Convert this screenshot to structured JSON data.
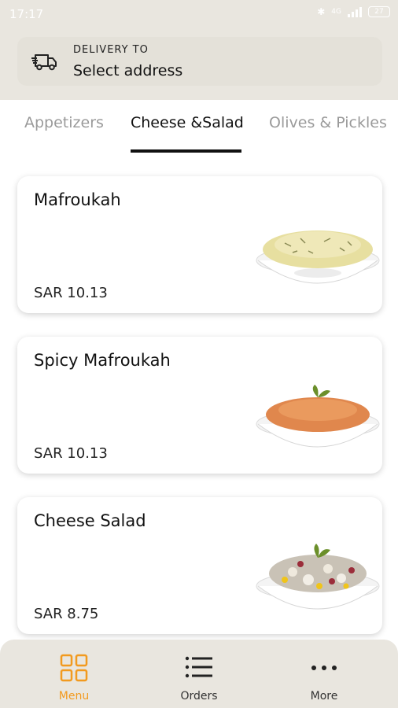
{
  "status_bar": {
    "time": "17:17",
    "network": "4G",
    "battery": "27"
  },
  "delivery": {
    "label": "DELIVERY TO",
    "value": "Select address"
  },
  "tabs": [
    {
      "label": "Appetizers",
      "active": false
    },
    {
      "label": "Cheese &Salad",
      "active": true
    },
    {
      "label": "Olives & Pickles",
      "active": false
    }
  ],
  "items": [
    {
      "name": "Mafroukah",
      "price": "SAR 10.13",
      "image": "mafroukah-dish"
    },
    {
      "name": "Spicy Mafroukah",
      "price": "SAR 10.13",
      "image": "spicy-mafroukah-dish"
    },
    {
      "name": "Cheese Salad",
      "price": "SAR 8.75",
      "image": "cheese-salad-dish"
    }
  ],
  "bottom_nav": [
    {
      "label": "Menu",
      "icon": "grid-icon",
      "active": true
    },
    {
      "label": "Orders",
      "icon": "list-icon",
      "active": false
    },
    {
      "label": "More",
      "icon": "more-icon",
      "active": false
    }
  ],
  "colors": {
    "accent": "#f29a1f",
    "header_bg": "#e9e6df"
  }
}
